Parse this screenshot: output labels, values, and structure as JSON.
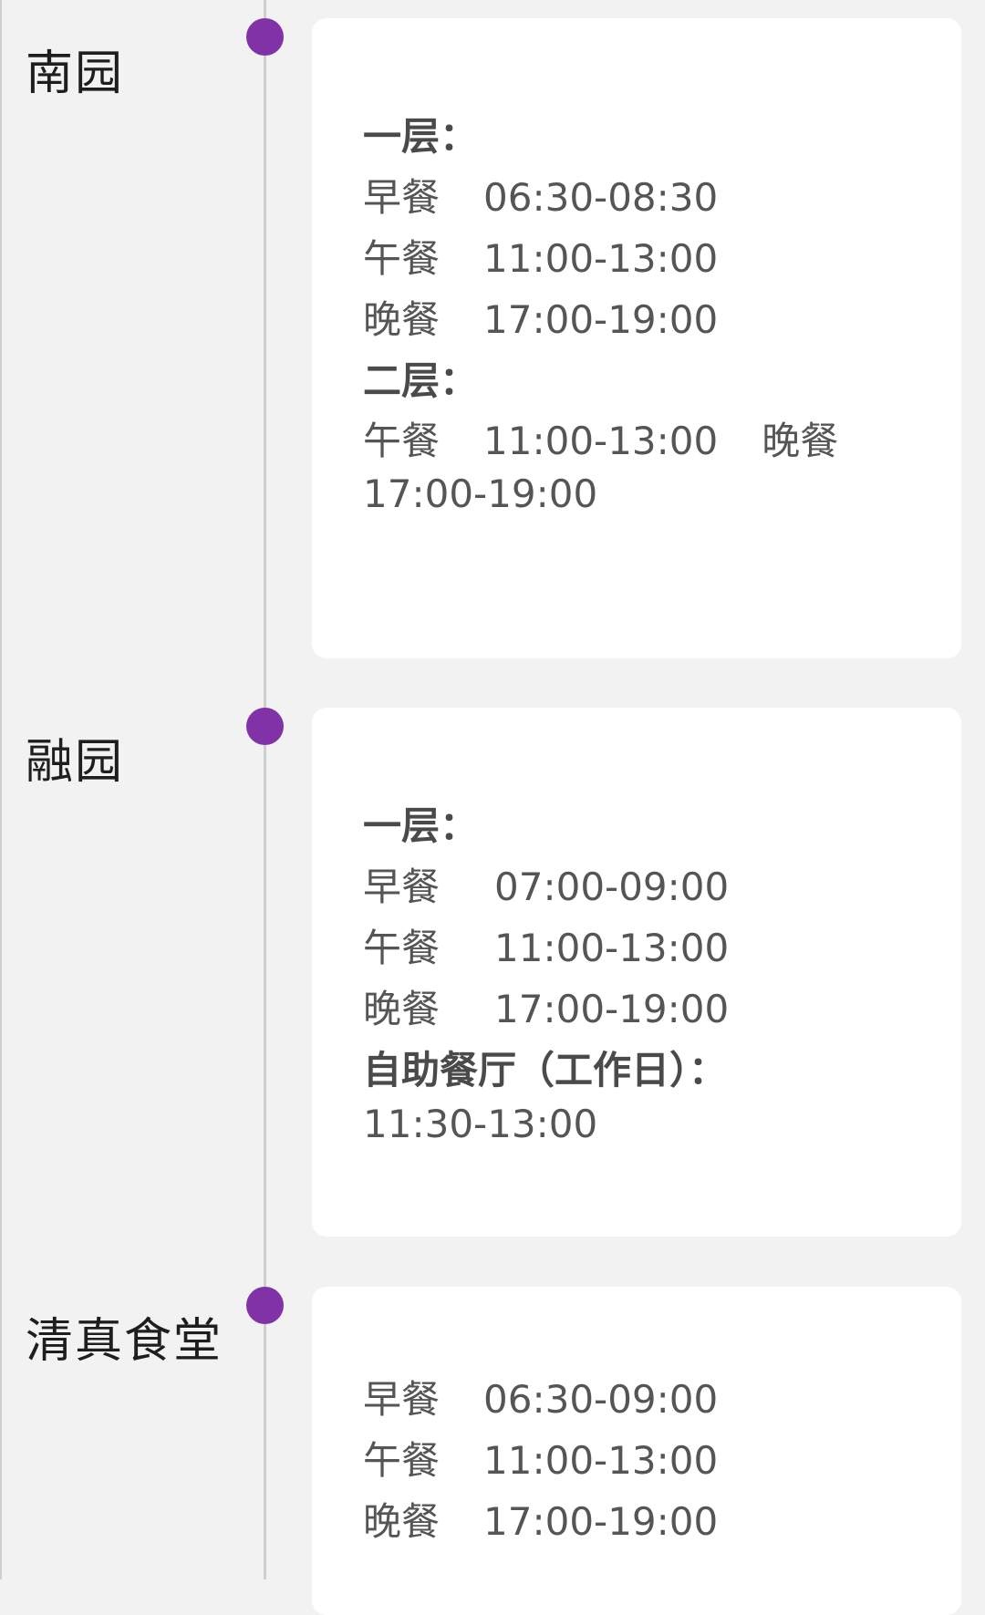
{
  "accent_color": "#8032a6",
  "sections": [
    {
      "title": "南园",
      "lines": [
        {
          "type": "heading",
          "text": "一层："
        },
        {
          "type": "meal",
          "meal": "早餐",
          "time": "06:30-08:30"
        },
        {
          "type": "meal",
          "meal": "午餐",
          "time": "11:00-13:00"
        },
        {
          "type": "meal",
          "meal": "晚餐",
          "time": "17:00-19:00"
        },
        {
          "type": "heading",
          "text": "二层："
        },
        {
          "type": "meal2",
          "meal": "午餐",
          "time": "11:00-13:00",
          "meal_b": "晚餐",
          "time_b": "17:00-19:00"
        }
      ]
    },
    {
      "title": "融园",
      "lines": [
        {
          "type": "heading",
          "text": "一层："
        },
        {
          "type": "meal",
          "meal": "早餐",
          "time": "07:00-09:00"
        },
        {
          "type": "meal",
          "meal": "午餐",
          "time": "11:00-13:00"
        },
        {
          "type": "meal",
          "meal": "晚餐",
          "time": "17:00-19:00"
        },
        {
          "type": "heading",
          "text": "自助餐厅（工作日）："
        },
        {
          "type": "plain",
          "text": "11:30-13:00"
        }
      ]
    },
    {
      "title": "清真食堂",
      "lines": [
        {
          "type": "meal",
          "meal": "早餐",
          "time": "06:30-09:00"
        },
        {
          "type": "meal",
          "meal": "午餐",
          "time": "11:00-13:00"
        },
        {
          "type": "meal",
          "meal": "晚餐",
          "time": "17:00-19:00"
        }
      ]
    }
  ]
}
